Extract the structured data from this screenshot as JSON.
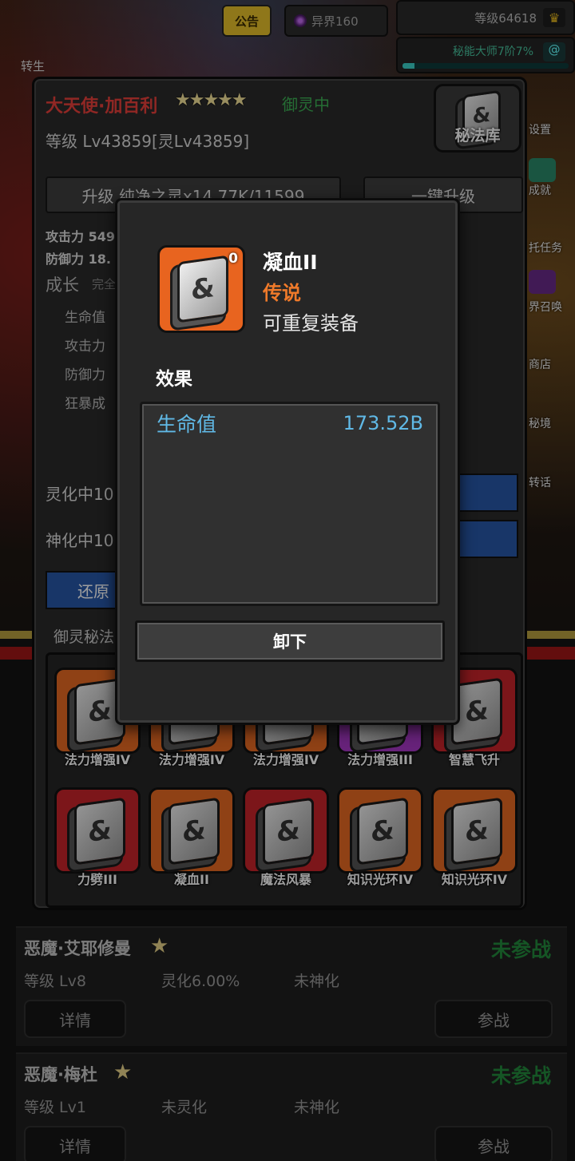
{
  "topbar": {
    "notice": "公告",
    "otherworld": "异界160",
    "level": "等级64618",
    "master": "秘能大师7阶7%",
    "master_progress": 0.07,
    "rebirth": "转生"
  },
  "side_menu": [
    "设置",
    "成就",
    "托任务",
    "界召唤",
    "商店",
    "秘境",
    "转话"
  ],
  "panel": {
    "hero_name": "大天使·加百利",
    "stars": "★★★★★",
    "status": "御灵中",
    "level": "等级 Lv43859[灵Lv43859]",
    "library": "秘法库",
    "upgrade_btn": "升级 纯净之灵x14.77K/11599",
    "oneclick_btn": "一键升级",
    "attack": "攻击力 549",
    "defense": "防御力 18.",
    "growth_title": "成长",
    "growth_sub": "完全",
    "growth_items": [
      "生命值",
      "攻击力",
      "防御力",
      "狂暴成"
    ],
    "spirit_rows": [
      "灵化中10",
      "神化中10"
    ],
    "restore_btn": "还原",
    "secret_title": "御灵秘法",
    "tiles": [
      {
        "label": "法力增强IV",
        "color": "orange"
      },
      {
        "label": "法力增强IV",
        "color": "orange"
      },
      {
        "label": "法力增强IV",
        "color": "orange"
      },
      {
        "label": "法力增强III",
        "color": "purple"
      },
      {
        "label": "智慧飞升",
        "color": "red"
      },
      {
        "label": "力劈III",
        "color": "red"
      },
      {
        "label": "凝血II",
        "color": "orange"
      },
      {
        "label": "魔法风暴",
        "color": "red"
      },
      {
        "label": "知识光环IV",
        "color": "orange"
      },
      {
        "label": "知识光环IV",
        "color": "orange"
      }
    ]
  },
  "heroes": [
    {
      "name": "恶魔·艾耶修曼",
      "status": "未参战",
      "level": "等级 Lv8",
      "spirit": "灵化6.00%",
      "divine": "未神化",
      "detail": "详情",
      "join": "参战"
    },
    {
      "name": "恶魔·梅杜",
      "status": "未参战",
      "level": "等级 Lv1",
      "spirit": "未灵化",
      "divine": "未神化",
      "detail": "详情",
      "join": "参战"
    }
  ],
  "modal": {
    "item_name": "凝血II",
    "rarity": "传说",
    "equip_note": "可重复装备",
    "count": "0",
    "effect_title": "效果",
    "effect_label": "生命值",
    "effect_value": "173.52B",
    "unequip": "卸下"
  },
  "colors": {
    "accent_blue": "#2757a8",
    "legend": "#f07a2a",
    "effect": "#60b9e6",
    "active_green": "#3db155"
  }
}
